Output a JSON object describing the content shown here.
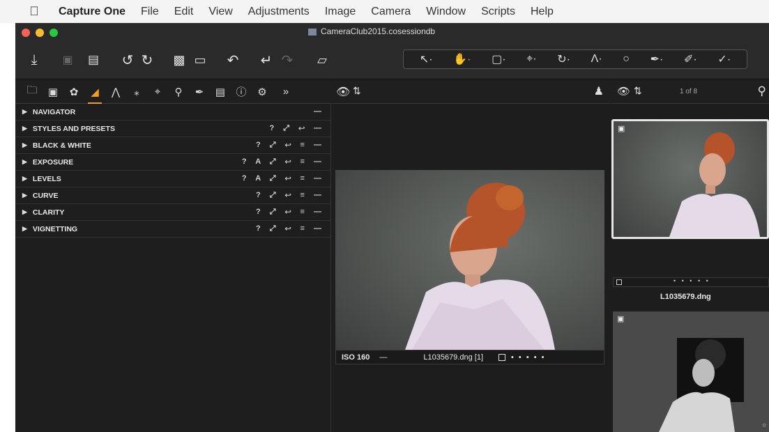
{
  "menubar": {
    "app": "Capture One",
    "items": [
      "File",
      "Edit",
      "View",
      "Adjustments",
      "Image",
      "Camera",
      "Window",
      "Scripts",
      "Help"
    ]
  },
  "window": {
    "title": "CameraClub2015.cosessiondb"
  },
  "tool_panel": {
    "sections": [
      {
        "label": "NAVIGATOR",
        "icons": "—"
      },
      {
        "label": "STYLES AND PRESETS",
        "icons": "? ⤢ ↩ —"
      },
      {
        "label": "BLACK & WHITE",
        "icons": "? ⤢ ↩ ≡ —"
      },
      {
        "label": "EXPOSURE",
        "icons": "? A ⤢ ↩ ≡ —"
      },
      {
        "label": "LEVELS",
        "icons": "? A ⤢ ↩ ≡ —"
      },
      {
        "label": "CURVE",
        "icons": "? ⤢ ↩ ≡ —"
      },
      {
        "label": "CLARITY",
        "icons": "? ⤢ ↩ ≡ —"
      },
      {
        "label": "VIGNETTING",
        "icons": "? ⤢ ↩ ≡ —"
      }
    ]
  },
  "viewer": {
    "iso": "ISO 160",
    "dash": "—",
    "filename": "L1035679.dng [1]",
    "rating_dots": "• • • • •"
  },
  "browser": {
    "count": "1 of 8",
    "thumb_dots": "• • • • •",
    "thumb_label": "L1035679.dng"
  },
  "colors": {
    "accent": "#f0a020",
    "window_bg": "#1e1e1e",
    "traffic_red": "#fe5f57",
    "traffic_yellow": "#febc2e",
    "traffic_green": "#28c840"
  }
}
